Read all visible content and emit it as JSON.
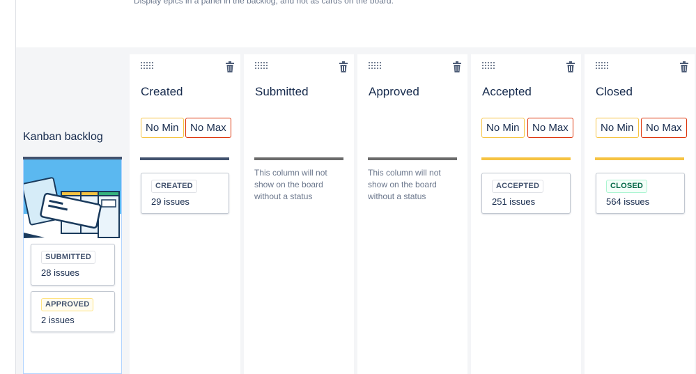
{
  "description": "Display epics in a panel in the backlog, and not as cards on the board.",
  "backlog": {
    "title": "Kanban backlog",
    "cards": [
      {
        "status": "SUBMITTED",
        "count": "28 issues"
      },
      {
        "status": "APPROVED",
        "count": "2 issues"
      }
    ]
  },
  "columns": [
    {
      "title": "Created",
      "min_label": "No Min",
      "max_label": "No Max",
      "card": {
        "status": "CREATED",
        "count": "29 issues"
      },
      "bar_color": "#42526e"
    },
    {
      "title": "Submitted",
      "note": "This column will not show on the board without a status",
      "bar_color": "#6b6b6b"
    },
    {
      "title": "Approved",
      "note": "This column will not show on the board without a status",
      "bar_color": "#6b6b6b"
    },
    {
      "title": "Accepted",
      "min_label": "No Min",
      "max_label": "No Max",
      "card": {
        "status": "ACCEPTED",
        "count": "251 issues"
      },
      "bar_color": "#f6c342"
    },
    {
      "title": "Closed",
      "min_label": "No Min",
      "max_label": "No Max",
      "card": {
        "status": "CLOSED",
        "count": "564 issues"
      },
      "bar_color": "#f6c342"
    }
  ],
  "icons": {
    "drag": "drag-handle-icon",
    "delete": "trash-icon"
  },
  "colors": {
    "limit_min_border": "#f6c342",
    "limit_max_border": "#de350b",
    "backlog_border": "#b3d4ff"
  }
}
